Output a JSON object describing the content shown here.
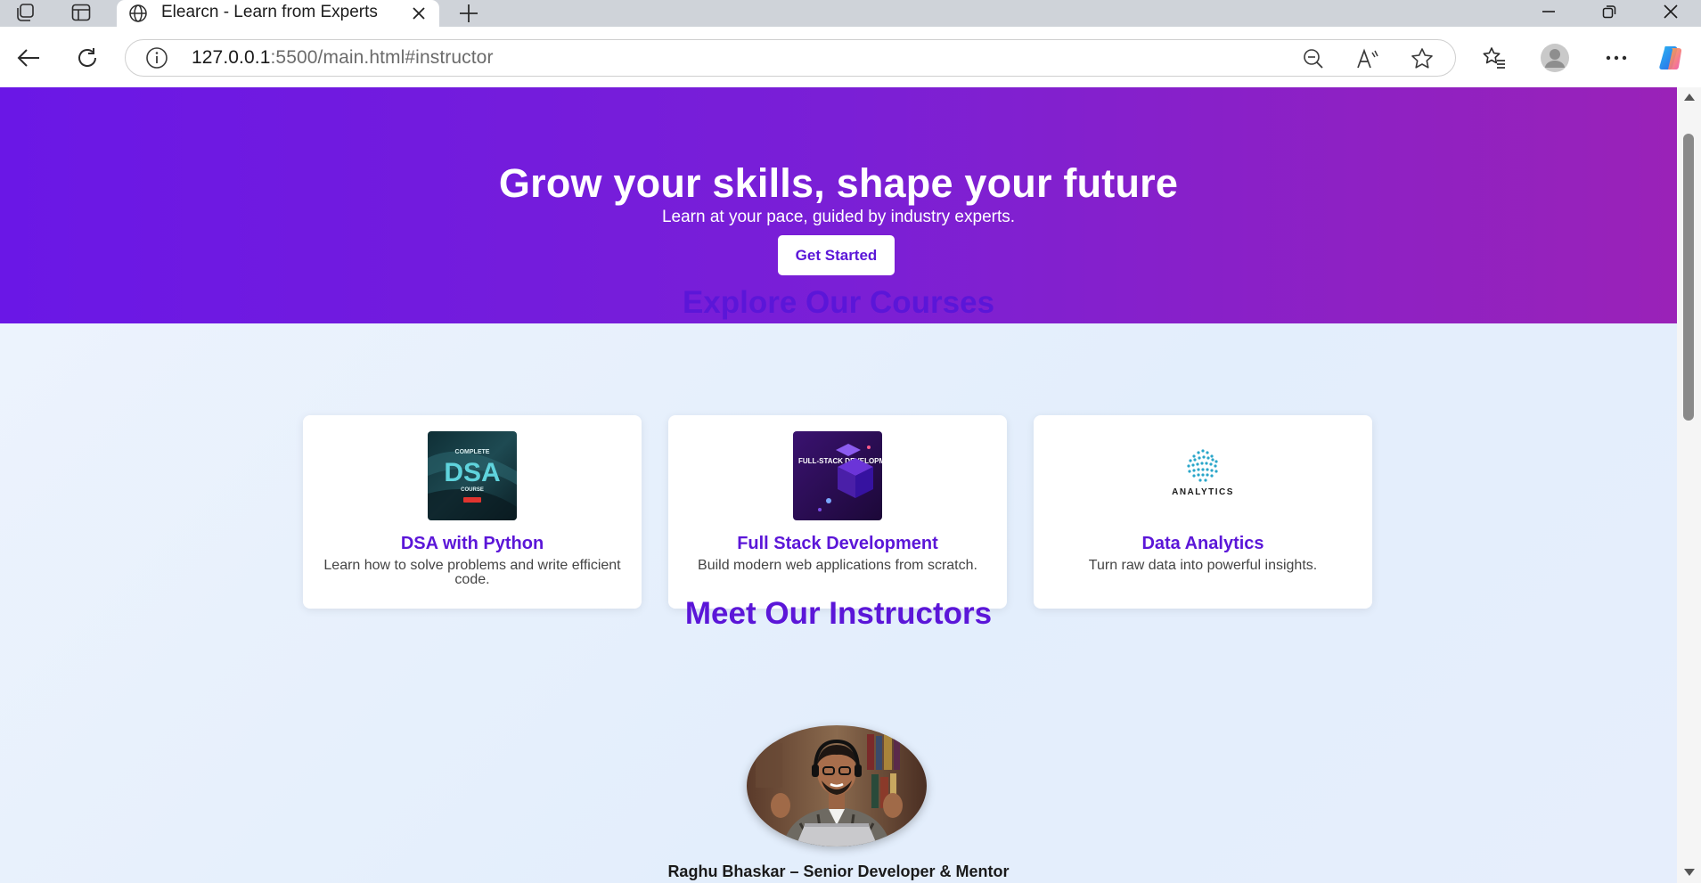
{
  "browser": {
    "tab_title": "Elearcn - Learn from Experts",
    "url_host": "127.0.0.1",
    "url_rest": ":5500/main.html#instructor"
  },
  "hero": {
    "title": "Grow your skills, shape your future",
    "subtitle": "Learn at your pace, guided by industry experts.",
    "cta_label": "Get Started",
    "gradient_start": "#6a17e6",
    "gradient_end": "#9a22b8"
  },
  "courses": {
    "title": "Explore Our Courses",
    "items": [
      {
        "title": "DSA with Python",
        "description": "Learn how to solve problems and write efficient code.",
        "image_text_top": "COMPLETE",
        "image_text_main": "DSA",
        "image_text_bottom": "COURSE"
      },
      {
        "title": "Full Stack Development",
        "description": "Build modern web applications from scratch.",
        "image_text_main": "FULL-STACK DEVELOPMENT"
      },
      {
        "title": "Data Analytics",
        "description": "Turn raw data into powerful insights.",
        "image_text_main": "ANALYTICS"
      }
    ]
  },
  "instructors": {
    "title": "Meet Our Instructors",
    "items": [
      {
        "name": "Raghu Bhaskar – Senior Developer & Mentor"
      }
    ]
  },
  "colors": {
    "accent": "#5b16d8"
  }
}
